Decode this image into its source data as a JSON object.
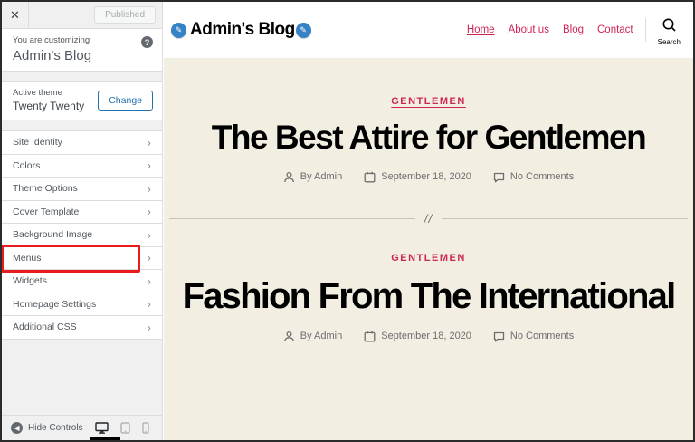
{
  "customizer": {
    "topbar": {
      "close_glyph": "✕",
      "publish_button": "Published"
    },
    "intro": {
      "kicker": "You are customizing",
      "site_title": "Admin's Blog",
      "help_glyph": "?"
    },
    "theme": {
      "label": "Active theme",
      "name": "Twenty Twenty",
      "change_button": "Change"
    },
    "sections": [
      {
        "label": "Site Identity"
      },
      {
        "label": "Colors"
      },
      {
        "label": "Theme Options"
      },
      {
        "label": "Cover Template"
      },
      {
        "label": "Background Image"
      },
      {
        "label": "Menus",
        "highlighted": true
      },
      {
        "label": "Widgets"
      },
      {
        "label": "Homepage Settings"
      },
      {
        "label": "Additional CSS"
      }
    ],
    "footer": {
      "hide_controls": "Hide Controls"
    }
  },
  "preview": {
    "site_title": "Admin's Blog",
    "nav": [
      {
        "label": "Home",
        "active": true
      },
      {
        "label": "About us"
      },
      {
        "label": "Blog"
      },
      {
        "label": "Contact"
      }
    ],
    "search_label": "Search",
    "separator_glyph": "//",
    "posts": [
      {
        "category": "GENTLEMEN",
        "title": "The Best Attire for Gentlemen",
        "author": "By Admin",
        "date": "September 18, 2020",
        "comments": "No Comments"
      },
      {
        "category": "GENTLEMEN",
        "title": "Fashion From The International",
        "author": "By Admin",
        "date": "September 18, 2020",
        "comments": "No Comments"
      }
    ]
  },
  "colors": {
    "accent": "#cd2653",
    "cream_background": "#f3eee2",
    "highlight_red": "#e81c1c",
    "wp_blue": "#2271b1",
    "edit_icon_blue": "#3582c4"
  }
}
